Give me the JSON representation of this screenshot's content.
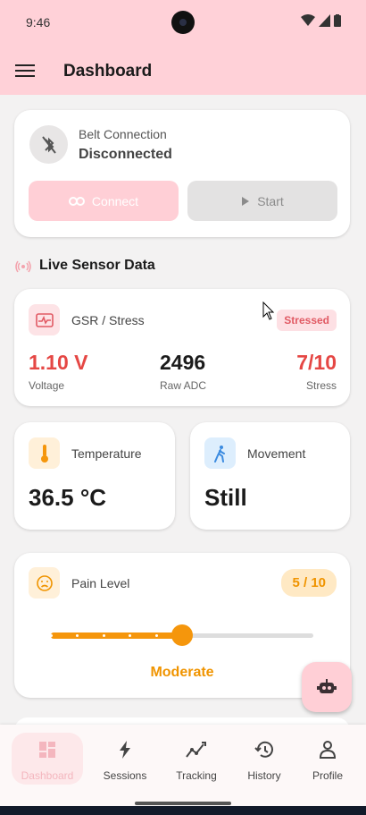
{
  "status_bar": {
    "time": "9:46"
  },
  "header": {
    "title": "Dashboard",
    "menu_icon": "menu-icon"
  },
  "belt": {
    "label": "Belt Connection",
    "status": "Disconnected",
    "connect_label": "Connect",
    "start_label": "Start"
  },
  "live": {
    "section_title": "Live Sensor Data"
  },
  "gsr": {
    "title": "GSR / Stress",
    "badge": "Stressed",
    "voltage_value": "1.10 V",
    "voltage_label": "Voltage",
    "adc_value": "2496",
    "adc_label": "Raw ADC",
    "stress_value": "7/10",
    "stress_label": "Stress"
  },
  "temperature": {
    "title": "Temperature",
    "value": "36.5 °C"
  },
  "movement": {
    "title": "Movement",
    "value": "Still"
  },
  "pain": {
    "title": "Pain Level",
    "badge": "5 / 10",
    "level": 5,
    "max": 10,
    "label": "Moderate"
  },
  "colors": {
    "accent_pink": "#ffd1d8",
    "stress_red": "#e54744",
    "pain_orange": "#f5960c"
  },
  "nav": {
    "items": [
      {
        "label": "Dashboard",
        "icon": "dashboard-icon",
        "active": true
      },
      {
        "label": "Sessions",
        "icon": "bolt-icon",
        "active": false
      },
      {
        "label": "Tracking",
        "icon": "trend-icon",
        "active": false
      },
      {
        "label": "History",
        "icon": "history-icon",
        "active": false
      },
      {
        "label": "Profile",
        "icon": "person-icon",
        "active": false
      }
    ]
  }
}
